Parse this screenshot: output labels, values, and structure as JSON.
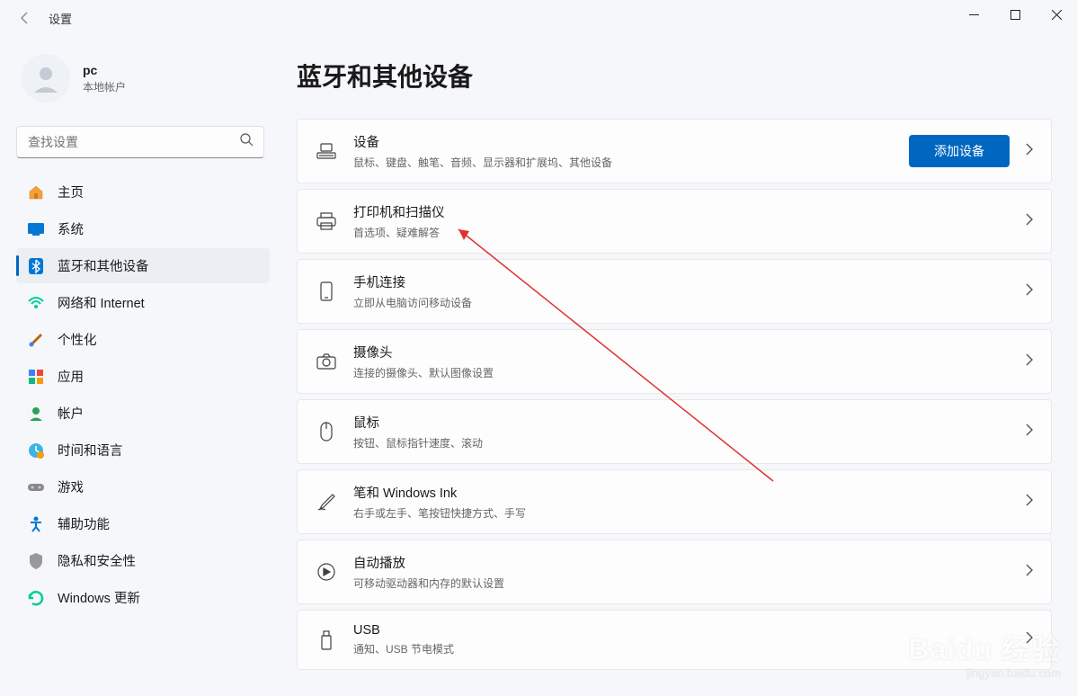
{
  "app": {
    "title": "设置"
  },
  "user": {
    "name": "pc",
    "sub": "本地帐户"
  },
  "search": {
    "placeholder": "查找设置"
  },
  "nav": {
    "home": "主页",
    "system": "系统",
    "bluetooth": "蓝牙和其他设备",
    "network": "网络和 Internet",
    "personalization": "个性化",
    "apps": "应用",
    "accounts": "帐户",
    "time": "时间和语言",
    "gaming": "游戏",
    "accessibility": "辅助功能",
    "privacy": "隐私和安全性",
    "update": "Windows 更新"
  },
  "page": {
    "title": "蓝牙和其他设备"
  },
  "cards": {
    "devices": {
      "title": "设备",
      "sub": "鼠标、键盘、触笔、音频、显示器和扩展坞、其他设备",
      "action": "添加设备"
    },
    "printers": {
      "title": "打印机和扫描仪",
      "sub": "首选项、疑难解答"
    },
    "phone": {
      "title": "手机连接",
      "sub": "立即从电脑访问移动设备"
    },
    "camera": {
      "title": "摄像头",
      "sub": "连接的摄像头、默认图像设置"
    },
    "mouse": {
      "title": "鼠标",
      "sub": "按钮、鼠标指针速度、滚动"
    },
    "pen": {
      "title": "笔和 Windows Ink",
      "sub": "右手或左手、笔按钮快捷方式、手写"
    },
    "autoplay": {
      "title": "自动播放",
      "sub": "可移动驱动器和内存的默认设置"
    },
    "usb": {
      "title": "USB",
      "sub": "通知、USB 节电模式"
    }
  },
  "watermark": {
    "logo": "Baidu 经验",
    "url": "jingyan.baidu.com"
  }
}
